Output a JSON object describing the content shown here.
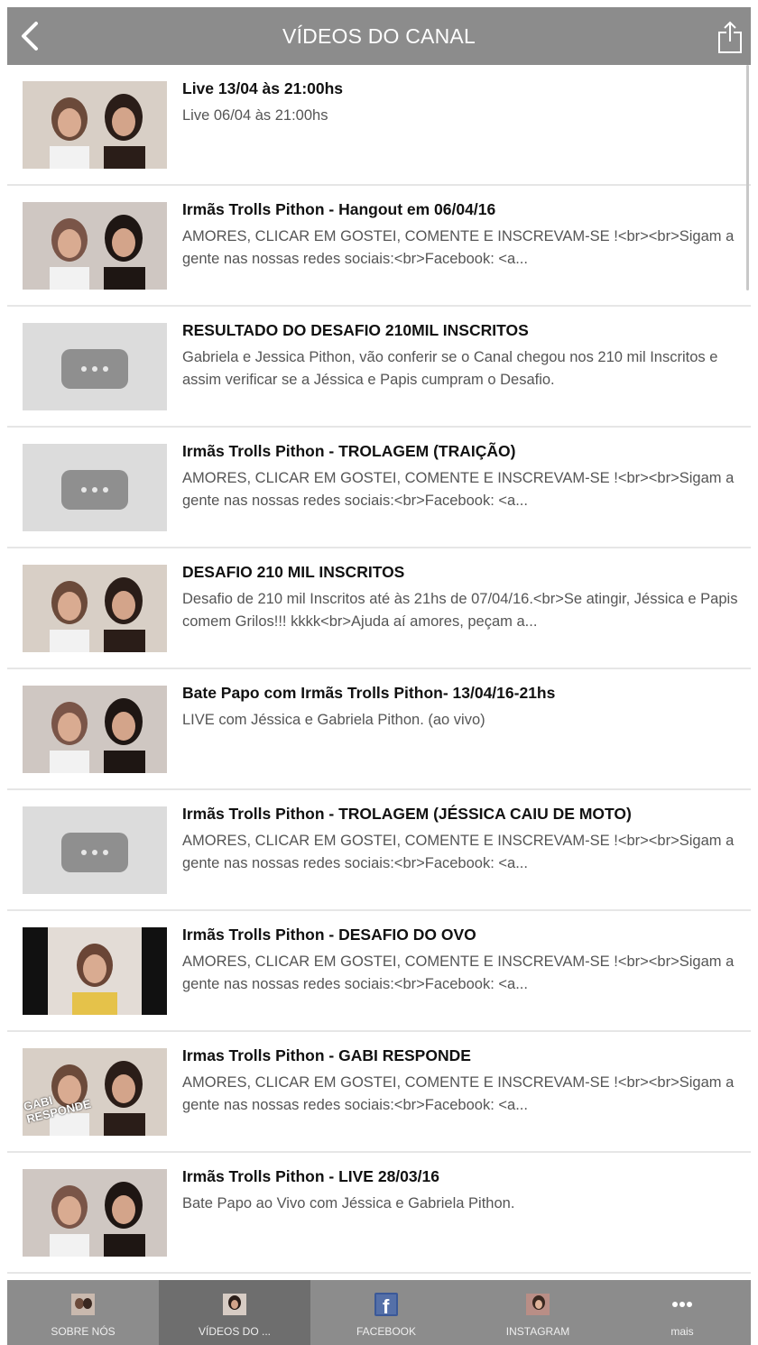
{
  "header": {
    "title": "VÍDEOS DO CANAL",
    "back_icon": "chevron-left-icon",
    "share_icon": "share-icon"
  },
  "videos": [
    {
      "title": "Live 13/04 às 21:00hs",
      "description": "Live 06/04 às 21:00hs",
      "thumbnail": "photo"
    },
    {
      "title": "Irmãs Trolls Pithon - Hangout em 06/04/16",
      "description": "AMORES, CLICAR EM GOSTEI, COMENTE E INSCREVAM-SE !<br><br>Sigam a gente nas nossas redes sociais:<br>Facebook: <a...",
      "thumbnail": "photo"
    },
    {
      "title": "RESULTADO DO DESAFIO 210MIL INSCRITOS",
      "description": "Gabriela e Jessica Pithon, vão conferir se o Canal chegou nos 210 mil Inscritos e assim verificar se a Jéssica e Papis cumpram o Desafio.",
      "thumbnail": "placeholder"
    },
    {
      "title": "Irmãs Trolls Pithon - TROLAGEM (TRAIÇÃO)",
      "description": "AMORES, CLICAR EM GOSTEI, COMENTE E INSCREVAM-SE !<br><br>Sigam a gente nas nossas redes sociais:<br>Facebook: <a...",
      "thumbnail": "placeholder"
    },
    {
      "title": "DESAFIO 210 MIL INSCRITOS",
      "description": "Desafio de 210 mil Inscritos até às 21hs de 07/04/16.<br>Se atingir, Jéssica e Papis comem Grilos!!! kkkk<br>Ajuda aí amores, peçam a...",
      "thumbnail": "photo"
    },
    {
      "title": "Bate Papo com Irmãs Trolls Pithon- 13/04/16-21hs",
      "description": "LIVE com Jéssica e Gabriela Pithon. (ao vivo)",
      "thumbnail": "photo"
    },
    {
      "title": "Irmãs Trolls Pithon - TROLAGEM (JÉSSICA CAIU DE MOTO)",
      "description": "AMORES, CLICAR EM GOSTEI, COMENTE E INSCREVAM-SE !<br><br>Sigam a gente nas nossas redes sociais:<br>Facebook: <a...",
      "thumbnail": "placeholder"
    },
    {
      "title": "Irmãs Trolls Pithon - DESAFIO DO OVO",
      "description": "AMORES, CLICAR EM GOSTEI, COMENTE E INSCREVAM-SE !<br><br>Sigam a gente nas nossas redes sociais:<br>Facebook: <a...",
      "thumbnail": "photo"
    },
    {
      "title": "Irmas Trolls Pithon - GABI RESPONDE",
      "description": "AMORES, CLICAR EM GOSTEI, COMENTE E INSCREVAM-SE !<br><br>Sigam a gente nas nossas redes sociais:<br>Facebook: <a...",
      "thumbnail": "photo-gabi",
      "thumbnail_text": "GABI RESPONDE"
    },
    {
      "title": "Irmãs Trolls Pithon - LIVE 28/03/16",
      "description": "Bate Papo ao Vivo com Jéssica e Gabriela Pithon.",
      "thumbnail": "photo"
    }
  ],
  "tabs": [
    {
      "label": "SOBRE NÓS",
      "icon": "about-photo-icon",
      "active": false
    },
    {
      "label": "VÍDEOS DO ...",
      "icon": "videos-photo-icon",
      "active": true
    },
    {
      "label": "FACEBOOK",
      "icon": "facebook-icon",
      "active": false
    },
    {
      "label": "INSTAGRAM",
      "icon": "instagram-photo-icon",
      "active": false
    },
    {
      "label": "mais",
      "icon": "more-icon",
      "active": false
    }
  ],
  "colors": {
    "header_bg": "#8c8c8c",
    "tabbar_bg": "#8c8c8c",
    "tab_active_bg": "#6e6e6e",
    "placeholder_bg": "#dcdcdc",
    "placeholder_button": "#8f8f8f"
  }
}
